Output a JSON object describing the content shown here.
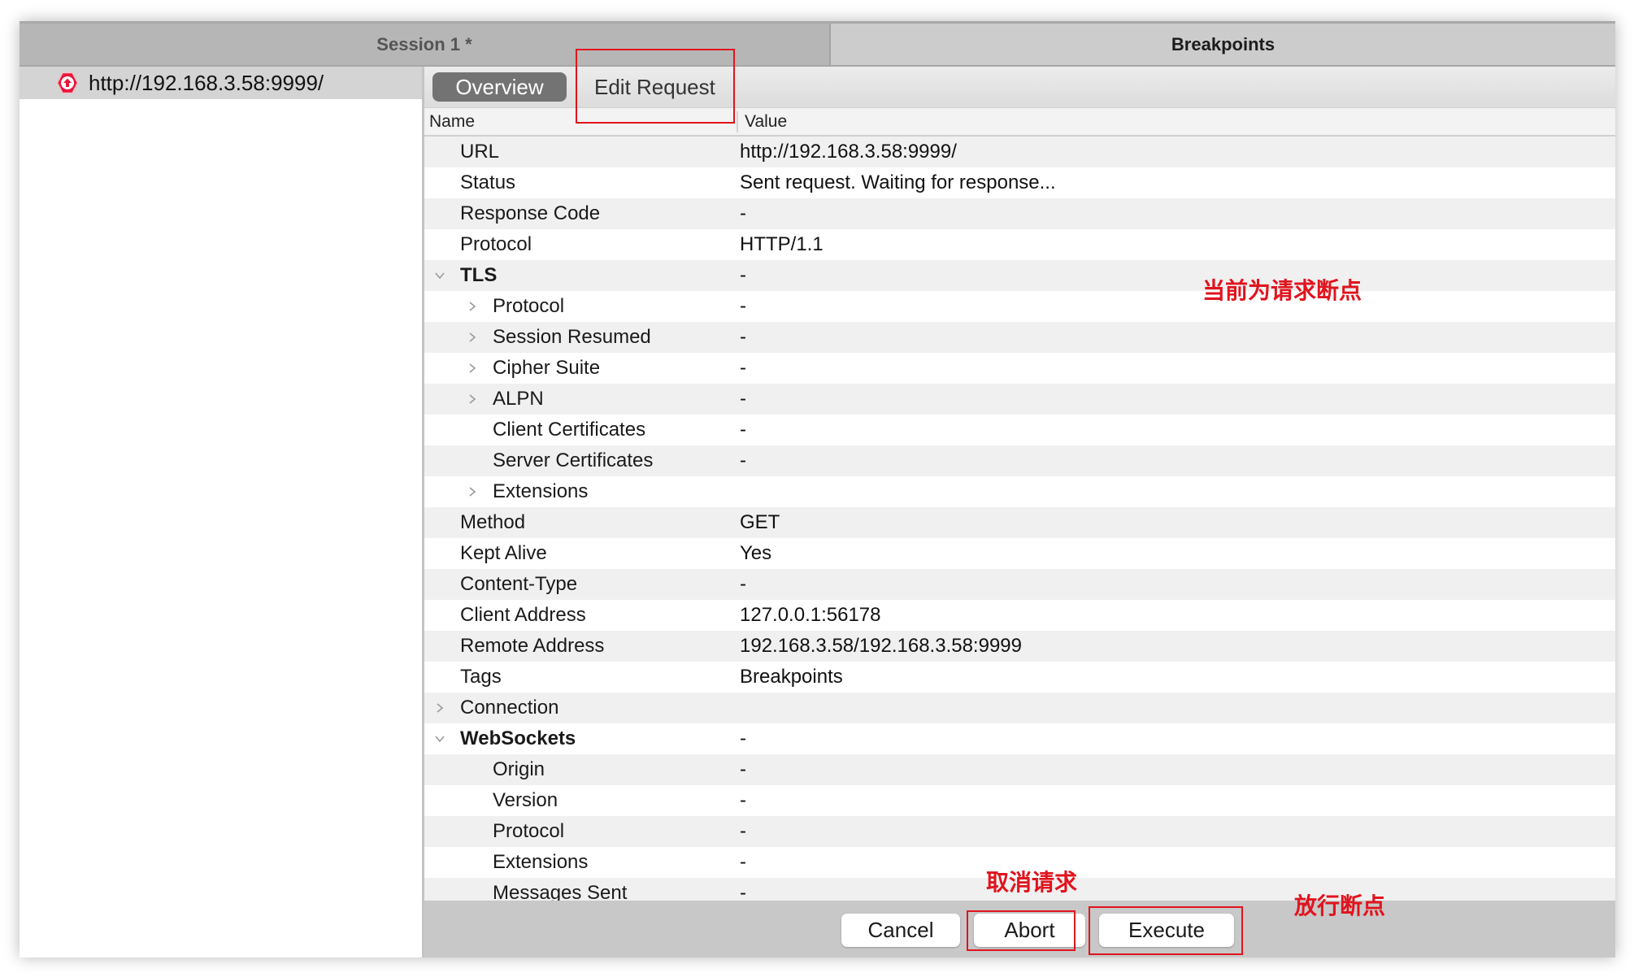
{
  "session_tabs": [
    {
      "label": "Session 1 *",
      "active": false
    },
    {
      "label": "Breakpoints",
      "active": true
    }
  ],
  "left_panel": {
    "items": [
      {
        "icon": "request-breakpoint-icon",
        "label": "http://192.168.3.58:9999/",
        "selected": true
      }
    ]
  },
  "detail_tabs": [
    {
      "label": "Overview",
      "selected": true
    },
    {
      "label": "Edit Request",
      "selected": false
    }
  ],
  "columns": {
    "name": "Name",
    "value": "Value"
  },
  "rows": [
    {
      "name": "URL",
      "value": "http://192.168.3.58:9999/",
      "level": 0,
      "toggle": "none",
      "bold": false
    },
    {
      "name": "Status",
      "value": "Sent request. Waiting for response...",
      "level": 0,
      "toggle": "none",
      "bold": false
    },
    {
      "name": "Response Code",
      "value": "-",
      "level": 0,
      "toggle": "none",
      "bold": false
    },
    {
      "name": "Protocol",
      "value": "HTTP/1.1",
      "level": 0,
      "toggle": "none",
      "bold": false
    },
    {
      "name": "TLS",
      "value": "-",
      "level": 0,
      "toggle": "expanded",
      "bold": true
    },
    {
      "name": "Protocol",
      "value": "-",
      "level": 1,
      "toggle": "collapsed",
      "bold": false
    },
    {
      "name": "Session Resumed",
      "value": "-",
      "level": 1,
      "toggle": "collapsed",
      "bold": false
    },
    {
      "name": "Cipher Suite",
      "value": "-",
      "level": 1,
      "toggle": "collapsed",
      "bold": false
    },
    {
      "name": "ALPN",
      "value": "-",
      "level": 1,
      "toggle": "collapsed",
      "bold": false
    },
    {
      "name": "Client Certificates",
      "value": "-",
      "level": 1,
      "toggle": "none",
      "bold": false
    },
    {
      "name": "Server Certificates",
      "value": "-",
      "level": 1,
      "toggle": "none",
      "bold": false
    },
    {
      "name": "Extensions",
      "value": "",
      "level": 1,
      "toggle": "collapsed",
      "bold": false
    },
    {
      "name": "Method",
      "value": "GET",
      "level": 0,
      "toggle": "none",
      "bold": false
    },
    {
      "name": "Kept Alive",
      "value": "Yes",
      "level": 0,
      "toggle": "none",
      "bold": false
    },
    {
      "name": "Content-Type",
      "value": "-",
      "level": 0,
      "toggle": "none",
      "bold": false
    },
    {
      "name": "Client Address",
      "value": "127.0.0.1:56178",
      "level": 0,
      "toggle": "none",
      "bold": false
    },
    {
      "name": "Remote Address",
      "value": "192.168.3.58/192.168.3.58:9999",
      "level": 0,
      "toggle": "none",
      "bold": false
    },
    {
      "name": "Tags",
      "value": "Breakpoints",
      "level": 0,
      "toggle": "none",
      "bold": false
    },
    {
      "name": "Connection",
      "value": "",
      "level": 0,
      "toggle": "collapsed",
      "bold": false
    },
    {
      "name": "WebSockets",
      "value": "-",
      "level": 0,
      "toggle": "expanded",
      "bold": true
    },
    {
      "name": "Origin",
      "value": "-",
      "level": 1,
      "toggle": "none",
      "bold": false
    },
    {
      "name": "Version",
      "value": "-",
      "level": 1,
      "toggle": "none",
      "bold": false
    },
    {
      "name": "Protocol",
      "value": "-",
      "level": 1,
      "toggle": "none",
      "bold": false
    },
    {
      "name": "Extensions",
      "value": "-",
      "level": 1,
      "toggle": "none",
      "bold": false
    },
    {
      "name": "Messages Sent",
      "value": "-",
      "level": 1,
      "toggle": "none",
      "bold": false
    }
  ],
  "buttons": {
    "cancel": "Cancel",
    "abort": "Abort",
    "execute": "Execute"
  },
  "annotations": {
    "request_breakpoint_note": "当前为请求断点",
    "abort_note": "取消请求",
    "execute_note": "放行断点",
    "color": "#e0141e"
  },
  "colors": {
    "icon_red": "#e8173a",
    "selected_pill": "#737373"
  }
}
